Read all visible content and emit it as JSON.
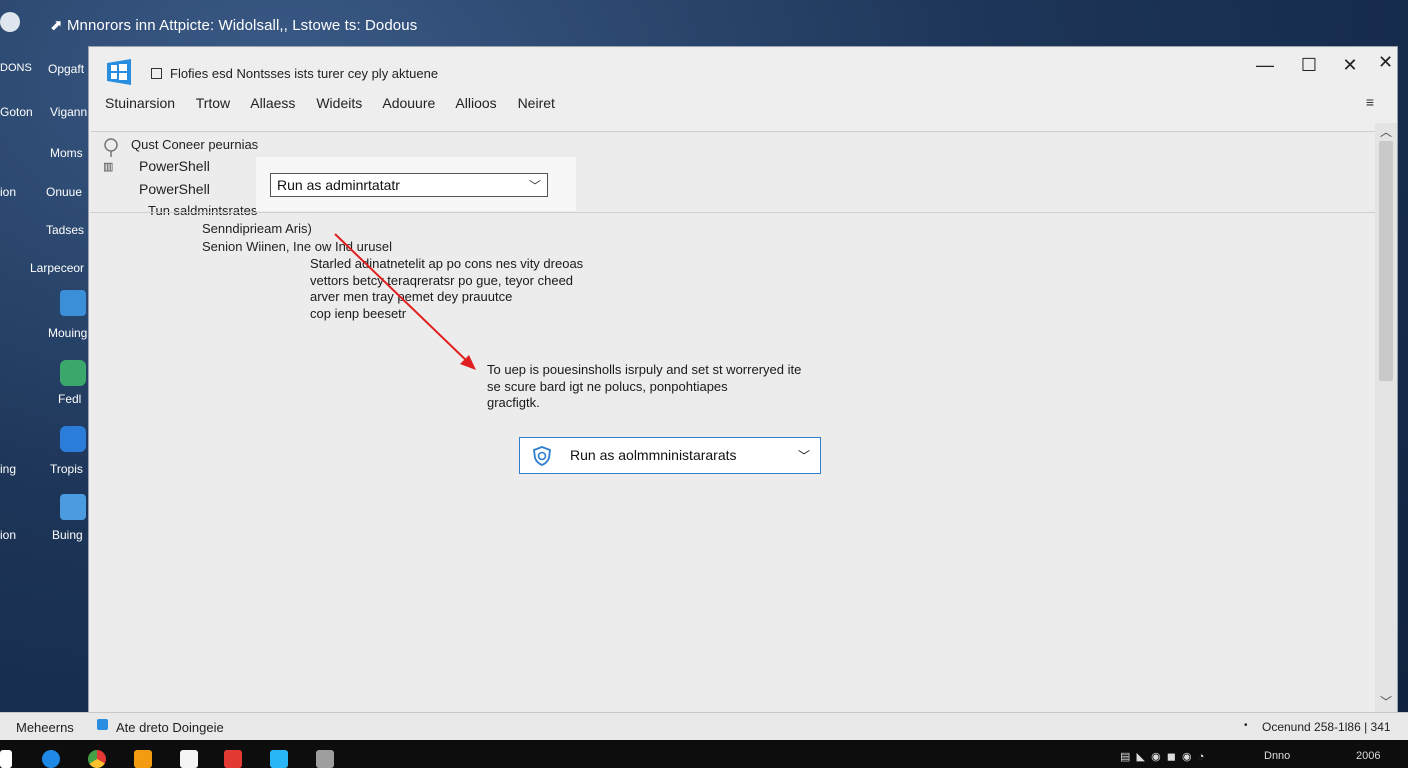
{
  "desktop": {
    "title": "Mnnorors inn Attpicte:   Widolsall,, Lstowe ts: Dodous",
    "left_labels": [
      "DONS",
      "Opgaft",
      "Goton",
      "Vigann",
      "Moms",
      "ion",
      "Onuue",
      "Tadses",
      "Larpeceor",
      "Mouing",
      "Fedl",
      "Tropis",
      "ing",
      "Buing",
      "ion"
    ]
  },
  "window": {
    "title": "Flofies esd Nontsses ists turer cey ply aktuene",
    "controls": {
      "minimize": "—",
      "maximize": "☐",
      "close": "✕"
    },
    "outer_close": "✕",
    "menu": [
      "Stuinarsion",
      "Trtow",
      "Allaess",
      "Wideits",
      "Adouure",
      "Allioos",
      "Neiret"
    ]
  },
  "tree": {
    "header": "Qust Coneer peurnias",
    "items": [
      "PowerShell",
      "PowerShell"
    ],
    "sub1": "Tun saldmintsrates",
    "sub2": "Senndiprieam Aris)",
    "sub3": "Senion Wiinen, Ine ow Ind urusel"
  },
  "dropdown_top": {
    "value": "Run as adminrtatatr"
  },
  "description1": [
    "Starled adinatnetelit ap po cons nes vity dreoas",
    "vettors betcy teraqreratsr po gue, teyor cheed",
    "arver men tray pemet dey prauutce",
    "cop ienp beesetr"
  ],
  "description2": [
    "To uep is pouesinsholls isrpuly and set st worreryed ite",
    "se scure bard igt ne polucs, ponpohtiapes",
    "gracfigtk."
  ],
  "run_button": {
    "label": "Run as aolmmninistararats"
  },
  "statusbar": {
    "left": "Meheerns",
    "center": "Ate dreto Doingeie",
    "right": "Ocenund 258-1l86 | 341"
  },
  "tray": {
    "time": "Dnno",
    "date": "2006"
  },
  "colors": {
    "accent": "#2f7fd1",
    "arrow": "#e02020",
    "desktop": "#1d3558"
  }
}
